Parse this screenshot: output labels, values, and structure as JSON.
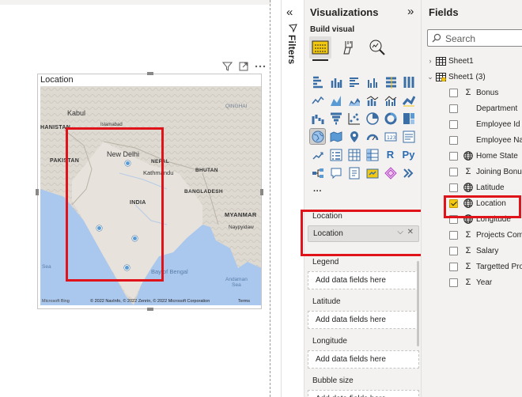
{
  "colors": {
    "highlight": "#e0121a",
    "pane_bg": "#f3f2f1",
    "accent_yellow": "#f2c811",
    "map_pin": "#5b9bd5"
  },
  "visual": {
    "title": "Location",
    "header_icons": [
      "filter-icon",
      "focus-mode-icon",
      "more-options-icon"
    ],
    "map": {
      "labels": {
        "afghanistan": "HANISTAN",
        "kabul": "Kabul",
        "islamabad": "Islamabad",
        "qinghai": "QINGHAI",
        "pakistan": "PAKISTAN",
        "new_delhi": "New Delhi",
        "nepal": "NEPAL",
        "kathmandu": "Kathmandu",
        "bhutan": "BHUTAN",
        "india": "INDIA",
        "bangladesh": "BANGLADESH",
        "myanmar": "MYANMAR",
        "naypyidaw": "Naypyidaw",
        "bay_of_bengal": "Bay of Bengal",
        "andaman_sea": "Andaman\nSea",
        "sea": "Sea"
      },
      "footer": {
        "logo": "Microsoft Bing",
        "credit": "© 2022 NavInfo, © 2022 Zenrin, © 2022 Microsoft Corporation",
        "terms": "Terms"
      }
    }
  },
  "filters": {
    "collapse_glyph": "«",
    "label": "Filters"
  },
  "visualizations": {
    "title": "Visualizations",
    "expand_glyph": "»",
    "build_visual_label": "Build visual",
    "ellipsis": "···",
    "r_label": "R",
    "py_label": "Py",
    "wells": [
      {
        "label": "Location",
        "field": "Location",
        "chevron": "⌵",
        "remove": "✕"
      },
      {
        "label": "Legend",
        "placeholder": "Add data fields here"
      },
      {
        "label": "Latitude",
        "placeholder": "Add data fields here"
      },
      {
        "label": "Longitude",
        "placeholder": "Add data fields here"
      },
      {
        "label": "Bubble size",
        "placeholder": "Add data fields here"
      }
    ]
  },
  "fields": {
    "title": "Fields",
    "search_placeholder": "Search",
    "tables": [
      {
        "name": "Sheet1",
        "caret": "›"
      },
      {
        "name": "Sheet1 (3)",
        "caret": "⌄"
      }
    ],
    "items": [
      {
        "name": "Bonus",
        "type": "Σ",
        "checked": false
      },
      {
        "name": "Department",
        "type": "",
        "checked": false
      },
      {
        "name": "Employee Id",
        "type": "",
        "checked": false
      },
      {
        "name": "Employee Name",
        "type": "",
        "checked": false
      },
      {
        "name": "Home State",
        "type": "globe",
        "checked": false
      },
      {
        "name": "Joining Bonus",
        "type": "Σ",
        "checked": false
      },
      {
        "name": "Latitude",
        "type": "globe",
        "checked": false
      },
      {
        "name": "Location",
        "type": "globe",
        "checked": true
      },
      {
        "name": "Longitude",
        "type": "globe",
        "checked": false
      },
      {
        "name": "Projects Completed",
        "type": "Σ",
        "checked": false
      },
      {
        "name": "Salary",
        "type": "Σ",
        "checked": false
      },
      {
        "name": "Targetted Projects",
        "type": "Σ",
        "checked": false
      },
      {
        "name": "Year",
        "type": "Σ",
        "checked": false
      }
    ]
  }
}
